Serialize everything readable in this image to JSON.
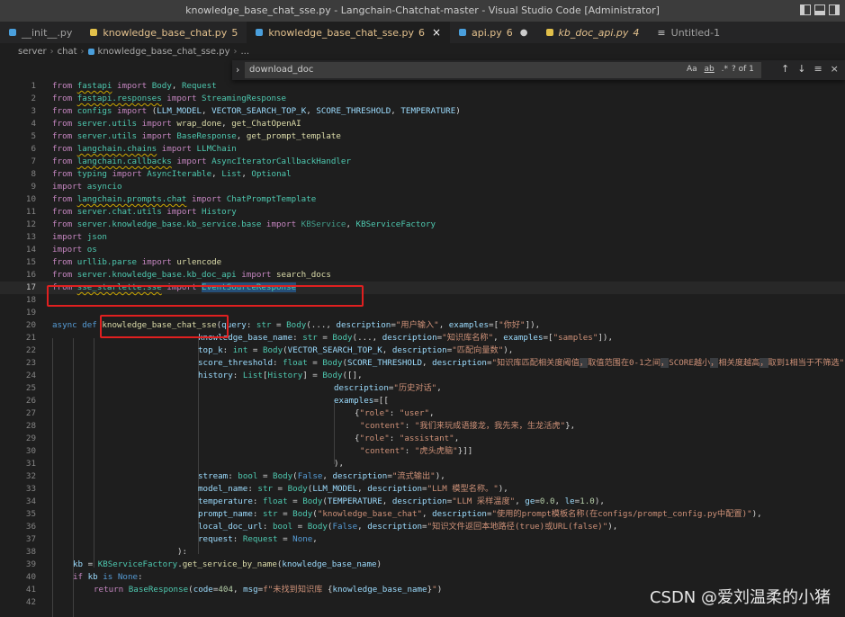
{
  "window": {
    "title": "knowledge_base_chat_sse.py - Langchain-Chatchat-master - Visual Studio Code [Administrator]"
  },
  "tabs": [
    {
      "label": "__init__.py",
      "count": "",
      "state": "",
      "icon": "python-icon"
    },
    {
      "label": "knowledge_base_chat.py",
      "count": "5",
      "state": "",
      "icon": "python-icon"
    },
    {
      "label": "knowledge_base_chat_sse.py",
      "count": "6",
      "state": "×",
      "icon": "python-icon"
    },
    {
      "label": "api.py",
      "count": "6",
      "state": "●",
      "icon": "python-icon"
    },
    {
      "label": "kb_doc_api.py",
      "count": "4",
      "state": "",
      "icon": "python-icon"
    },
    {
      "label": "Untitled-1",
      "count": "",
      "state": "",
      "icon": "lines-icon"
    }
  ],
  "breadcrumb": {
    "segments": [
      "server",
      "chat",
      "knowledge_base_chat_sse.py",
      "..."
    ]
  },
  "find": {
    "value": "download_doc",
    "match_case": "Aa",
    "whole_word": "ab",
    "regex": ".*",
    "count": "? of 1",
    "prev": "↑",
    "next": "↓",
    "menu": "≡",
    "close": "×"
  },
  "editor": {
    "line_numbers": [
      "1",
      "2",
      "3",
      "4",
      "5",
      "6",
      "7",
      "8",
      "9",
      "10",
      "11",
      "12",
      "13",
      "14",
      "15",
      "16",
      "17",
      "18",
      "19",
      "20",
      "21",
      "22",
      "23",
      "24",
      "25",
      "26",
      "27",
      "28",
      "29",
      "30",
      "31",
      "32",
      "33",
      "34",
      "35",
      "36",
      "37",
      "38",
      "39",
      "40",
      "41",
      "42"
    ],
    "current_line": "17"
  },
  "watermark": "CSDN @爱刘温柔的小猪"
}
